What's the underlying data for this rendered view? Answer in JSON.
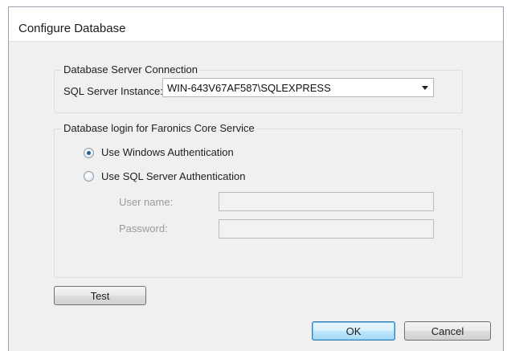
{
  "window": {
    "title": "Configure Database"
  },
  "connection": {
    "group_label": "Database Server Connection",
    "instance_label": "SQL Server Instance:",
    "instance_value": "WIN-643V67AF587\\SQLEXPRESS"
  },
  "login": {
    "group_label": "Database login for Faronics Core Service",
    "options": [
      {
        "label": "Use Windows Authentication",
        "selected": true
      },
      {
        "label": "Use SQL Server Authentication",
        "selected": false
      }
    ],
    "username_label": "User name:",
    "username_value": "",
    "password_label": "Password:",
    "password_value": ""
  },
  "buttons": {
    "test": "Test",
    "ok": "OK",
    "cancel": "Cancel"
  }
}
